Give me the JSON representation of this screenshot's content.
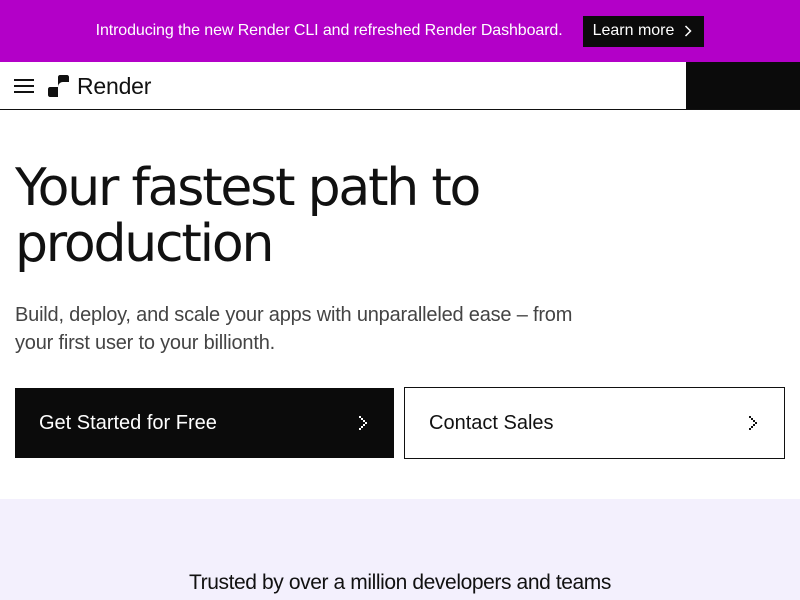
{
  "announcement": {
    "text": "Introducing the new Render CLI and refreshed Render Dashboard.",
    "button_label": "Learn more",
    "background": "#b300c8"
  },
  "nav": {
    "menu_icon": "hamburger-icon",
    "logo_icon": "render-logo-icon",
    "logo_text": "Render"
  },
  "hero": {
    "title_line1": "Your fastest path to",
    "title_line2": "production",
    "subtitle_line1": "Build, deploy, and scale your apps with unparalleled ease – from",
    "subtitle_line2": "your first user to your billionth."
  },
  "cta": {
    "primary_label": "Get Started for Free",
    "secondary_label": "Contact Sales",
    "arrow_icon": "chevron-right-icon"
  },
  "trusted": {
    "text": "Trusted by over a million developers and teams",
    "background": "#f3f0fd"
  }
}
